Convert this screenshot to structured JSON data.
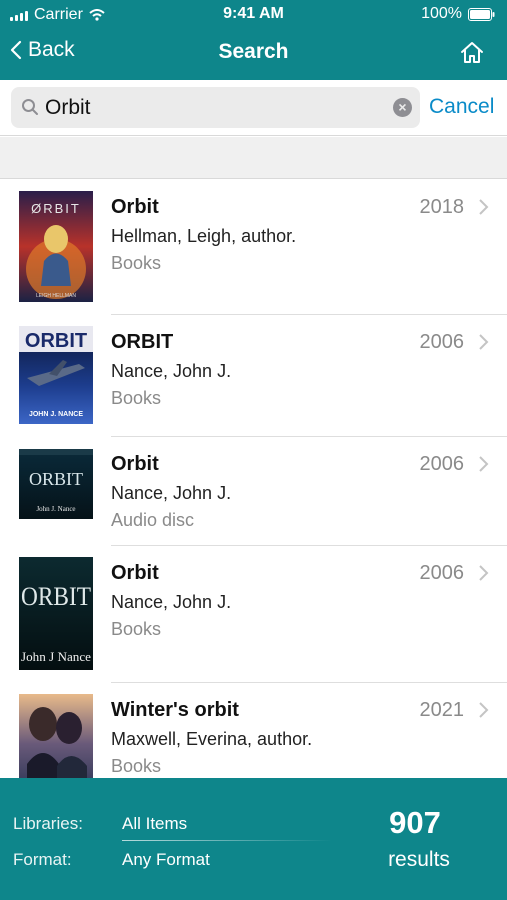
{
  "status_bar": {
    "carrier": "Carrier",
    "time": "9:41 AM",
    "battery": "100%"
  },
  "nav": {
    "back_label": "Back",
    "title": "Search",
    "home_icon": "home-icon"
  },
  "search": {
    "value": "Orbit",
    "placeholder": "",
    "cancel_label": "Cancel"
  },
  "results": [
    {
      "title": "Orbit",
      "year": "2018",
      "author": "Hellman, Leigh, author.",
      "format": "Books",
      "cover_text": "ØRBIT",
      "cover_subtext": "LEIGH HELLMAN"
    },
    {
      "title": "ORBIT",
      "year": "2006",
      "author": "Nance, John J.",
      "format": "Books",
      "cover_text": "ORBIT",
      "cover_subtext": "JOHN J. NANCE"
    },
    {
      "title": "Orbit",
      "year": "2006",
      "author": "Nance, John J.",
      "format": "Audio disc",
      "cover_text": "ORBIT",
      "cover_subtext": "John J. Nance"
    },
    {
      "title": "Orbit",
      "year": "2006",
      "author": "Nance, John J.",
      "format": "Books",
      "cover_text": "ORBIT",
      "cover_subtext": "John J Nance"
    },
    {
      "title": "Winter's orbit",
      "year": "2021",
      "author": "Maxwell, Everina, author.",
      "format": "Books",
      "cover_text": "",
      "cover_subtext": ""
    }
  ],
  "footer": {
    "libraries_label": "Libraries:",
    "libraries_value": "All Items",
    "format_label": "Format:",
    "format_value": "Any Format",
    "count": "907",
    "count_label": "results"
  },
  "colors": {
    "brand": "#0e868b",
    "link": "#0a8bc8",
    "secondary_text": "#8a8a8a"
  }
}
